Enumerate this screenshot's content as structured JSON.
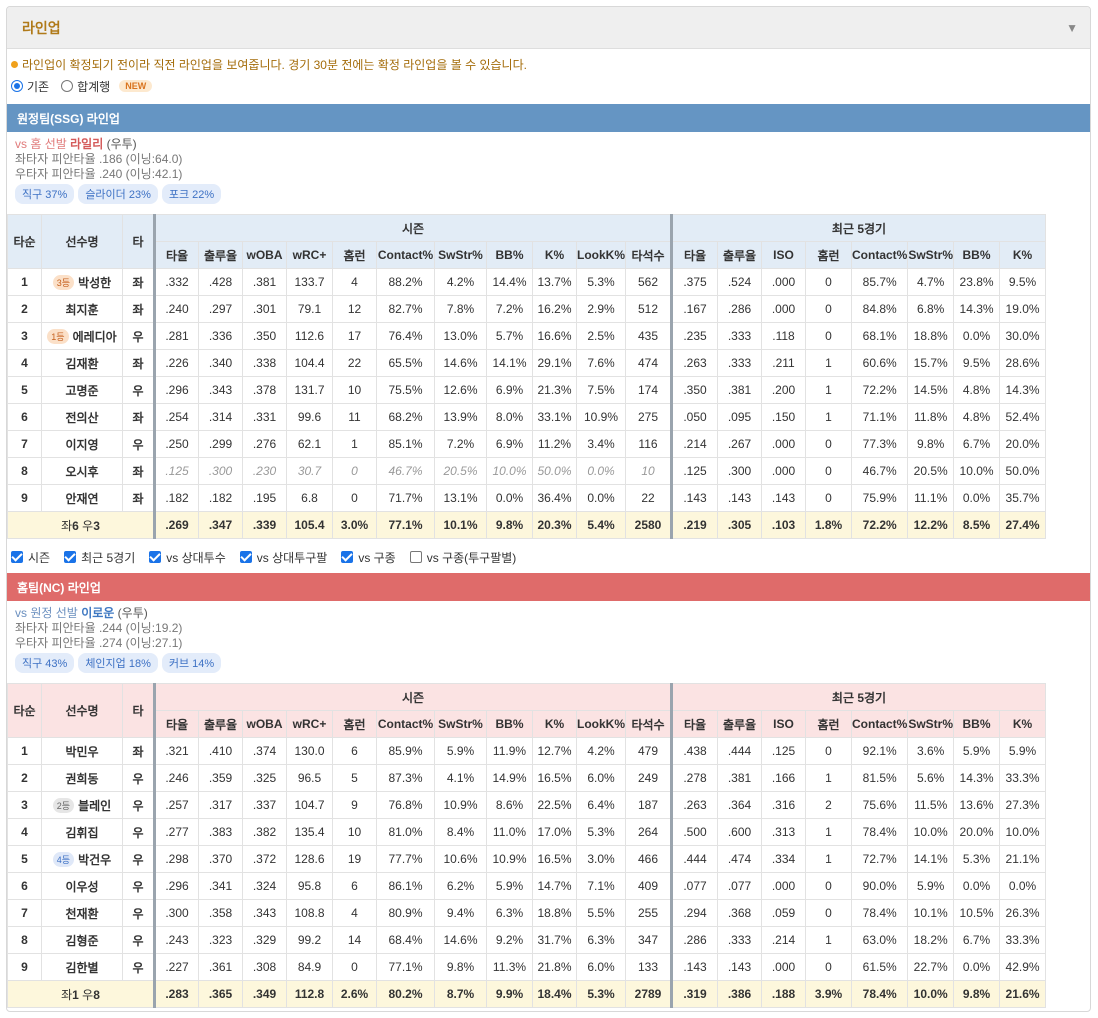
{
  "panel": {
    "title": "라인업",
    "chevron": "▼"
  },
  "notice": "라인업이 확정되기 전이라 직전 라인업을 보여줍니다. 경기 30분 전에는 확정 라인업을 볼 수 있습니다.",
  "view_mode": {
    "options": [
      "기존",
      "합계행"
    ],
    "selected": "기존",
    "new_badge": "NEW"
  },
  "headers": {
    "order": "타순",
    "player": "선수명",
    "hand": "타",
    "season": "시즌",
    "recent": "최근 5경기",
    "season_cols": [
      "타율",
      "출루율",
      "wOBA",
      "wRC+",
      "홈런",
      "Contact%",
      "SwStr%",
      "BB%",
      "K%",
      "LookK%",
      "타석수"
    ],
    "recent_cols": [
      "타율",
      "출루율",
      "ISO",
      "홈런",
      "Contact%",
      "SwStr%",
      "BB%",
      "K%",
      "LookK%"
    ]
  },
  "away": {
    "title": "원정팀(SSG) 라인업",
    "pitcher": {
      "vs": "vs 홈 선발",
      "name": "라일리",
      "hand": "(우투)",
      "vs_left": "좌타자 피안타율 .186 (이닝:64.0)",
      "vs_right": "우타자 피안타율 .240 (이닝:42.1)",
      "pitches": [
        "직구 37%",
        "슬라이더 23%",
        "포크 22%"
      ]
    },
    "rows": [
      {
        "order": "1",
        "badge": "3등",
        "badge_color": "orange",
        "name": "박성한",
        "hand": "좌",
        "season": [
          ".332",
          ".428",
          ".381",
          "133.7",
          "4",
          "88.2%",
          "4.2%",
          "14.4%",
          "13.7%",
          "5.3%",
          "562"
        ],
        "recent": [
          ".375",
          ".524",
          ".000",
          "0",
          "85.7%",
          "4.7%",
          "23.8%",
          "9.5%",
          "0.0%"
        ]
      },
      {
        "order": "2",
        "badge": "",
        "name": "최지훈",
        "hand": "좌",
        "season": [
          ".240",
          ".297",
          ".301",
          "79.1",
          "12",
          "82.7%",
          "7.8%",
          "7.2%",
          "16.2%",
          "2.9%",
          "512"
        ],
        "recent": [
          ".167",
          ".286",
          ".000",
          "0",
          "84.8%",
          "6.8%",
          "14.3%",
          "19.0%",
          "0.0%"
        ]
      },
      {
        "order": "3",
        "badge": "1등",
        "badge_color": "orange",
        "name": "에레디아",
        "hand": "우",
        "season": [
          ".281",
          ".336",
          ".350",
          "112.6",
          "17",
          "76.4%",
          "13.0%",
          "5.7%",
          "16.6%",
          "2.5%",
          "435"
        ],
        "recent": [
          ".235",
          ".333",
          ".118",
          "0",
          "68.1%",
          "18.8%",
          "0.0%",
          "30.0%",
          "0.0%"
        ]
      },
      {
        "order": "4",
        "badge": "",
        "name": "김재환",
        "hand": "좌",
        "season": [
          ".226",
          ".340",
          ".338",
          "104.4",
          "22",
          "65.5%",
          "14.6%",
          "14.1%",
          "29.1%",
          "7.6%",
          "474"
        ],
        "recent": [
          ".263",
          ".333",
          ".211",
          "1",
          "60.6%",
          "15.7%",
          "9.5%",
          "28.6%",
          "0.0%"
        ]
      },
      {
        "order": "5",
        "badge": "",
        "name": "고명준",
        "hand": "우",
        "season": [
          ".296",
          ".343",
          ".378",
          "131.7",
          "10",
          "75.5%",
          "12.6%",
          "6.9%",
          "21.3%",
          "7.5%",
          "174"
        ],
        "recent": [
          ".350",
          ".381",
          ".200",
          "1",
          "72.2%",
          "14.5%",
          "4.8%",
          "14.3%",
          "0.0%"
        ]
      },
      {
        "order": "6",
        "badge": "",
        "name": "전의산",
        "hand": "좌",
        "season": [
          ".254",
          ".314",
          ".331",
          "99.6",
          "11",
          "68.2%",
          "13.9%",
          "8.0%",
          "33.1%",
          "10.9%",
          "275"
        ],
        "recent": [
          ".050",
          ".095",
          ".150",
          "1",
          "71.1%",
          "11.8%",
          "4.8%",
          "52.4%",
          "0.0%"
        ]
      },
      {
        "order": "7",
        "badge": "",
        "name": "이지영",
        "hand": "우",
        "season": [
          ".250",
          ".299",
          ".276",
          "62.1",
          "1",
          "85.1%",
          "7.2%",
          "6.9%",
          "11.2%",
          "3.4%",
          "116"
        ],
        "recent": [
          ".214",
          ".267",
          ".000",
          "0",
          "77.3%",
          "9.8%",
          "6.7%",
          "20.0%",
          "0.0%"
        ]
      },
      {
        "order": "8",
        "badge": "",
        "name": "오시후",
        "hand": "좌",
        "italic": true,
        "season": [
          ".125",
          ".300",
          ".230",
          "30.7",
          "0",
          "46.7%",
          "20.5%",
          "10.0%",
          "50.0%",
          "0.0%",
          "10"
        ],
        "recent": [
          ".125",
          ".300",
          ".000",
          "0",
          "46.7%",
          "20.5%",
          "10.0%",
          "50.0%",
          "0.0%"
        ]
      },
      {
        "order": "9",
        "badge": "",
        "name": "안재연",
        "hand": "좌",
        "season": [
          ".182",
          ".182",
          ".195",
          "6.8",
          "0",
          "71.7%",
          "13.1%",
          "0.0%",
          "36.4%",
          "0.0%",
          "22"
        ],
        "recent": [
          ".143",
          ".143",
          ".143",
          "0",
          "75.9%",
          "11.1%",
          "0.0%",
          "35.7%",
          "0.0%"
        ]
      }
    ],
    "total": {
      "label_pre": "좌",
      "left": "6",
      "label_mid": " 우",
      "right": "3",
      "season": [
        ".269",
        ".347",
        ".339",
        "105.4",
        "3.0%",
        "77.1%",
        "10.1%",
        "9.8%",
        "20.3%",
        "5.4%",
        "2580"
      ],
      "season_colors": [
        "r",
        "r",
        "r",
        "r",
        "g",
        "r",
        "r",
        "r",
        "r",
        "r",
        "k"
      ],
      "recent": [
        ".219",
        ".305",
        ".103",
        "1.8%",
        "72.2%",
        "12.2%",
        "8.5%",
        "27.4%",
        "0.0%"
      ],
      "recent_colors": [
        "r",
        "r",
        "r",
        "r",
        "r",
        "r",
        "r",
        "r",
        "k"
      ]
    }
  },
  "filters": [
    {
      "label": "시즌",
      "checked": true
    },
    {
      "label": "최근 5경기",
      "checked": true
    },
    {
      "label": "vs 상대투수",
      "checked": true
    },
    {
      "label": "vs 상대투구팔",
      "checked": true
    },
    {
      "label": "vs 구종",
      "checked": true
    },
    {
      "label": "vs 구종(투구팔별)",
      "checked": false
    }
  ],
  "home": {
    "title": "홈팀(NC) 라인업",
    "pitcher": {
      "vs": "vs 원정 선발",
      "name": "이로운",
      "hand": "(우투)",
      "vs_left": "좌타자 피안타율 .244 (이닝:19.2)",
      "vs_right": "우타자 피안타율 .274 (이닝:27.1)",
      "pitches": [
        "직구 43%",
        "체인지업 18%",
        "커브 14%"
      ]
    },
    "rows": [
      {
        "order": "1",
        "badge": "",
        "name": "박민우",
        "hand": "좌",
        "season": [
          ".321",
          ".410",
          ".374",
          "130.0",
          "6",
          "85.9%",
          "5.9%",
          "11.9%",
          "12.7%",
          "4.2%",
          "479"
        ],
        "recent": [
          ".438",
          ".444",
          ".125",
          "0",
          "92.1%",
          "3.6%",
          "5.9%",
          "5.9%",
          "0.0%"
        ]
      },
      {
        "order": "2",
        "badge": "",
        "name": "권희동",
        "hand": "우",
        "season": [
          ".246",
          ".359",
          ".325",
          "96.5",
          "5",
          "87.3%",
          "4.1%",
          "14.9%",
          "16.5%",
          "6.0%",
          "249"
        ],
        "recent": [
          ".278",
          ".381",
          ".166",
          "1",
          "81.5%",
          "5.6%",
          "14.3%",
          "33.3%",
          "0.0%"
        ]
      },
      {
        "order": "3",
        "badge": "2등",
        "badge_color": "gray",
        "name": "블레인",
        "hand": "우",
        "season": [
          ".257",
          ".317",
          ".337",
          "104.7",
          "9",
          "76.8%",
          "10.9%",
          "8.6%",
          "22.5%",
          "6.4%",
          "187"
        ],
        "recent": [
          ".263",
          ".364",
          ".316",
          "2",
          "75.6%",
          "11.5%",
          "13.6%",
          "27.3%",
          "0.0%"
        ]
      },
      {
        "order": "4",
        "badge": "",
        "name": "김휘집",
        "hand": "우",
        "season": [
          ".277",
          ".383",
          ".382",
          "135.4",
          "10",
          "81.0%",
          "8.4%",
          "11.0%",
          "17.0%",
          "5.3%",
          "264"
        ],
        "recent": [
          ".500",
          ".600",
          ".313",
          "1",
          "78.4%",
          "10.0%",
          "20.0%",
          "10.0%",
          "0.0%"
        ]
      },
      {
        "order": "5",
        "badge": "4등",
        "badge_color": "blue",
        "name": "박건우",
        "hand": "우",
        "season": [
          ".298",
          ".370",
          ".372",
          "128.6",
          "19",
          "77.7%",
          "10.6%",
          "10.9%",
          "16.5%",
          "3.0%",
          "466"
        ],
        "recent": [
          ".444",
          ".474",
          ".334",
          "1",
          "72.7%",
          "14.1%",
          "5.3%",
          "21.1%",
          "0.0%"
        ]
      },
      {
        "order": "6",
        "badge": "",
        "name": "이우성",
        "hand": "우",
        "season": [
          ".296",
          ".341",
          ".324",
          "95.8",
          "6",
          "86.1%",
          "6.2%",
          "5.9%",
          "14.7%",
          "7.1%",
          "409"
        ],
        "recent": [
          ".077",
          ".077",
          ".000",
          "0",
          "90.0%",
          "5.9%",
          "0.0%",
          "0.0%",
          "0.0%"
        ]
      },
      {
        "order": "7",
        "badge": "",
        "name": "천재환",
        "hand": "우",
        "season": [
          ".300",
          ".358",
          ".343",
          "108.8",
          "4",
          "80.9%",
          "9.4%",
          "6.3%",
          "18.8%",
          "5.5%",
          "255"
        ],
        "recent": [
          ".294",
          ".368",
          ".059",
          "0",
          "78.4%",
          "10.1%",
          "10.5%",
          "26.3%",
          "0.0%"
        ]
      },
      {
        "order": "8",
        "badge": "",
        "name": "김형준",
        "hand": "우",
        "season": [
          ".243",
          ".323",
          ".329",
          "99.2",
          "14",
          "68.4%",
          "14.6%",
          "9.2%",
          "31.7%",
          "6.3%",
          "347"
        ],
        "recent": [
          ".286",
          ".333",
          ".214",
          "1",
          "63.0%",
          "18.2%",
          "6.7%",
          "33.3%",
          "0.0%"
        ]
      },
      {
        "order": "9",
        "badge": "",
        "name": "김한별",
        "hand": "우",
        "season": [
          ".227",
          ".361",
          ".308",
          "84.9",
          "0",
          "77.1%",
          "9.8%",
          "11.3%",
          "21.8%",
          "6.0%",
          "133"
        ],
        "recent": [
          ".143",
          ".143",
          ".000",
          "0",
          "61.5%",
          "22.7%",
          "0.0%",
          "42.9%",
          "0.0%"
        ]
      }
    ],
    "total": {
      "label_pre": "좌",
      "left": "1",
      "label_mid": " 우",
      "right": "8",
      "season": [
        ".283",
        ".365",
        ".349",
        "112.8",
        "2.6%",
        "80.2%",
        "8.7%",
        "9.9%",
        "18.4%",
        "5.3%",
        "2789"
      ],
      "season_colors": [
        "g",
        "g",
        "g",
        "g",
        "r",
        "g",
        "g",
        "g",
        "g",
        "g",
        "k"
      ],
      "recent": [
        ".319",
        ".386",
        ".188",
        "3.9%",
        "78.4%",
        "10.0%",
        "9.8%",
        "21.6%",
        "0.0%"
      ],
      "recent_colors": [
        "g",
        "g",
        "g",
        "g",
        "g",
        "g",
        "g",
        "g",
        "k"
      ]
    }
  },
  "colors": {
    "away_bar": "#6595c3",
    "home_bar": "#df6b6a",
    "accent": "#1a73e8",
    "title": "#b07a19"
  }
}
